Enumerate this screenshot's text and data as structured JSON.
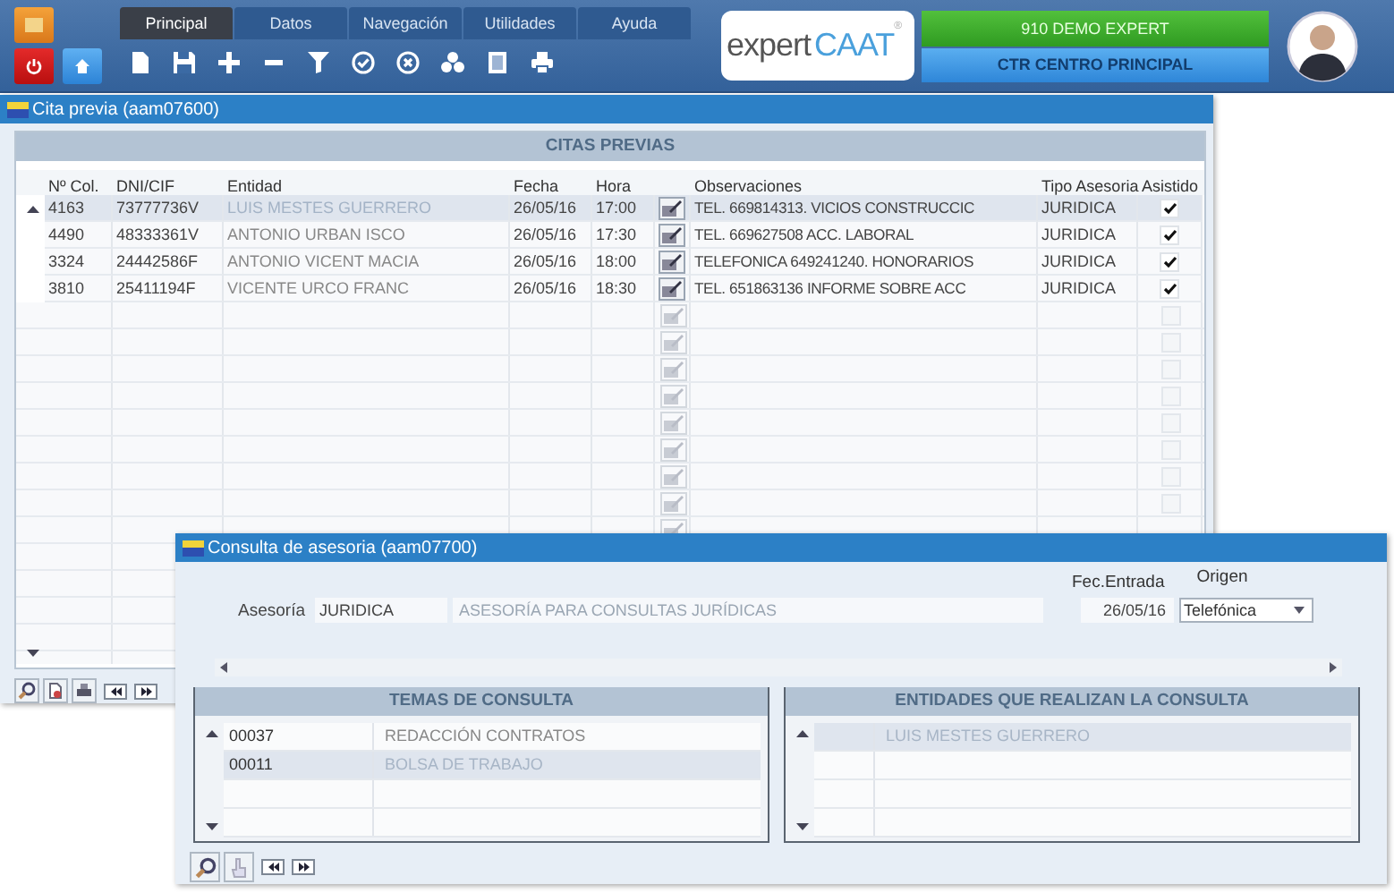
{
  "menu_tabs": [
    {
      "label": "Principal",
      "selected": true
    },
    {
      "label": "Datos",
      "selected": false
    },
    {
      "label": "Navegación",
      "selected": false
    },
    {
      "label": "Utilidades",
      "selected": false
    },
    {
      "label": "Ayuda",
      "selected": false
    }
  ],
  "logo": {
    "text": "expert",
    "accent": "CAAT",
    "mark": "®"
  },
  "company": "910 DEMO EXPERT",
  "center": "CTR CENTRO PRINCIPAL",
  "cita_window": {
    "title": "Cita previa (aam07600)",
    "section_title": "CITAS PREVIAS",
    "columns": [
      "Nº Col.",
      "DNI/CIF",
      "Entidad",
      "Fecha",
      "Hora",
      "Observaciones",
      "Tipo Asesoria",
      "Asistido"
    ],
    "rows": [
      {
        "n_col": "4163",
        "dni": "73777736V",
        "entidad": "LUIS MESTES GUERRERO",
        "fecha": "26/05/16",
        "hora": "17:00",
        "observaciones": "TEL. 669814313. VICIOS CONSTRUCCIC",
        "tipo": "JURIDICA",
        "asistido": true,
        "selected": true
      },
      {
        "n_col": "4490",
        "dni": "48333361V",
        "entidad": "ANTONIO URBAN ISCO",
        "fecha": "26/05/16",
        "hora": "17:30",
        "observaciones": "TEL. 669627508 ACC. LABORAL",
        "tipo": "JURIDICA",
        "asistido": true,
        "selected": false
      },
      {
        "n_col": "3324",
        "dni": "24442586F",
        "entidad": "ANTONIO VICENT MACIA",
        "fecha": "26/05/16",
        "hora": "18:00",
        "observaciones": "TELEFONICA 649241240. HONORARIOS",
        "tipo": "JURIDICA",
        "asistido": true,
        "selected": false
      },
      {
        "n_col": "3810",
        "dni": "25411194F",
        "entidad": "VICENTE URCO FRANC",
        "fecha": "26/05/16",
        "hora": "18:30",
        "observaciones": "TEL. 651863136 INFORME SOBRE ACC",
        "tipo": "JURIDICA",
        "asistido": true,
        "selected": false
      }
    ],
    "empty_rows": [
      {
        "asistido": false
      },
      {
        "asistido": false
      },
      {
        "asistido": false
      },
      {
        "asistido": false
      },
      {
        "asistido": false
      },
      {
        "asistido": false
      },
      {
        "asistido": false
      },
      {
        "asistido": false
      }
    ]
  },
  "consulta_window": {
    "title": "Consulta de asesoria (aam07700)",
    "asesoria_label": "Asesoría",
    "asesoria_code": "JURIDICA",
    "asesoria_desc": "ASESORÍA PARA CONSULTAS JURÍDICAS",
    "fec_entrada_label": "Fec.Entrada",
    "fec_entrada": "26/05/16",
    "origen_label": "Origen",
    "origen": "Telefónica",
    "temas": {
      "title": "TEMAS DE CONSULTA",
      "rows": [
        {
          "code": "00037",
          "name": "REDACCIÓN CONTRATOS",
          "selected": false
        },
        {
          "code": "00011",
          "name": "BOLSA DE TRABAJO",
          "selected": true
        }
      ]
    },
    "entidades": {
      "title": "ENTIDADES QUE REALIZAN LA CONSULTA",
      "rows": [
        {
          "name": "LUIS MESTES GUERRERO",
          "selected": true
        }
      ]
    }
  }
}
